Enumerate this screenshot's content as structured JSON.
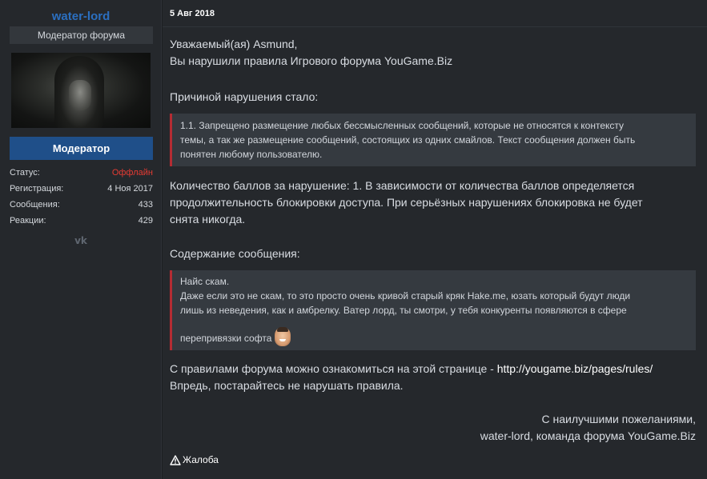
{
  "user": {
    "name": "water-lord",
    "title": "Модератор форума",
    "role": "Модератор",
    "stats": [
      {
        "label": "Статус:",
        "value": "Оффлайн",
        "status": "offline"
      },
      {
        "label": "Регистрация:",
        "value": "4 Ноя 2017"
      },
      {
        "label": "Сообщения:",
        "value": "433"
      },
      {
        "label": "Реакции:",
        "value": "429"
      }
    ],
    "social_icon": "vk-icon",
    "social_text": "vk"
  },
  "post": {
    "date": "5 Авг 2018",
    "greeting_1": "Уважаемый(ая) Asmund,",
    "greeting_2": "Вы нарушили правила Игрового форума YouGame.Biz",
    "reason_heading": "Причиной нарушения стало:",
    "rule_quote": [
      "1.1. Запрещено размещение любых бессмысленных сообщений, которые не относятся к контексту",
      "темы, а так же размещение сообщений, состоящих из одних смайлов. Текст сообщения должен быть",
      "понятен любому пользователю."
    ],
    "points_text": [
      "Количество баллов за нарушение: 1. В зависимости от количества баллов определяется",
      "продолжительность блокировки доступа. При серьёзных нарушениях блокировка не будет",
      "снята никогда."
    ],
    "content_heading": "Содержание сообщения:",
    "message_quote": [
      "Найс скам.",
      "Даже если это не скам, то это просто очень кривой старый кряк Hake.me, юзать который будут люди",
      "лишь из неведения, как и амбрелку. Ватер лорд, ты смотри, у тебя конкуренты появляются в сфере",
      "перепривязки софта"
    ],
    "rules_text": "С правилами форума можно ознакомиться на этой странице - ",
    "rules_link": "http://yougame.biz/pages/rules/",
    "closing": "Впредь, постарайтесь не нарушать правила.",
    "signature_1": "С наилучшими пожеланиями,",
    "signature_2": "water-lord, команда форума YouGame.Biz",
    "report_label": "Жалоба"
  },
  "colors": {
    "accent": "#2b6fc0",
    "role_badge": "#1f4f89",
    "offline": "#e53b33",
    "quote_border": "#b52c33"
  }
}
